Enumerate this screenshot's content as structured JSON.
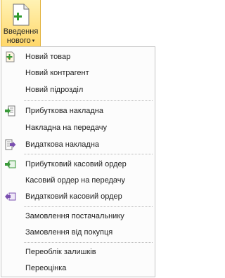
{
  "ribbon_button": {
    "label_line1": "Введення",
    "label_line2": "нового",
    "caret": "▾",
    "icon": "new-document-icon"
  },
  "menu": {
    "items": [
      {
        "label": "Новий товар",
        "icon": "new-item-icon"
      },
      {
        "label": "Новий контрагент",
        "icon": ""
      },
      {
        "label": "Новий підрозділ",
        "icon": ""
      },
      {
        "label": "Прибуткова накладна",
        "icon": "incoming-invoice-icon"
      },
      {
        "label": "Накладна на передачу",
        "icon": ""
      },
      {
        "label": "Видаткова накладна",
        "icon": "outgoing-invoice-icon"
      },
      {
        "label": "Прибутковий касовий ордер",
        "icon": "cash-in-icon"
      },
      {
        "label": "Касовий ордер на передачу",
        "icon": ""
      },
      {
        "label": "Видатковий касовий ордер",
        "icon": "cash-out-icon"
      },
      {
        "label": "Замовлення постачальнику",
        "icon": ""
      },
      {
        "label": "Замовлення від покупця",
        "icon": ""
      },
      {
        "label": "Переоблік залишків",
        "icon": ""
      },
      {
        "label": "Переоцінка",
        "icon": ""
      }
    ]
  },
  "colors": {
    "ribbon_active_bg": "#ffd76a",
    "ribbon_active_border": "#e2b23c",
    "green_icon": "#3a9a3a",
    "purple_icon": "#7a4fb0"
  }
}
